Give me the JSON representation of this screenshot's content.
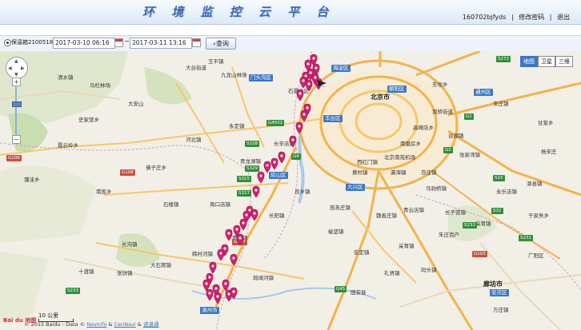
{
  "header": {
    "title": "环 境 监 控 云 平 台",
    "user": "160702bjfyds",
    "change_password": "修改密码",
    "logout": "退出",
    "sep": "|"
  },
  "toolbar": {
    "device": "保温箱21005183",
    "start_date": "2017-03-10 06:16",
    "end_date": "2017-03-11 13:16",
    "tilde": "~",
    "query": "查询"
  },
  "map": {
    "types": [
      "地图",
      "卫星",
      "三维"
    ],
    "active_type": "地图",
    "scale": "10 公里",
    "logo": "Bai du 地图",
    "copyright": {
      "prefix": "© 2015 Baidu - Data ©",
      "link1": "NavInfo",
      "amp": "&",
      "link2": "CenNavi",
      "amp2": "&",
      "link3": "道道通"
    },
    "place_labels": [
      {
        "text": "北京市",
        "big": true
      },
      {
        "text": "朝阳区",
        "badge": true
      },
      {
        "text": "海淀区",
        "badge": true
      },
      {
        "text": "门头沟区",
        "badge": true
      },
      {
        "text": "丰台区",
        "badge": true
      },
      {
        "text": "房山区",
        "badge": true
      },
      {
        "text": "大兴区",
        "badge": true
      },
      {
        "text": "通州区",
        "badge": true
      },
      {
        "text": "安次区",
        "badge": true
      },
      {
        "text": "涿州市",
        "badge": true
      },
      {
        "text": "廊坊市",
        "big": true
      },
      {
        "text": "大台街道"
      },
      {
        "text": "王平镇"
      },
      {
        "text": "清水镇"
      },
      {
        "text": "马栏林场"
      },
      {
        "text": "大安山"
      },
      {
        "text": "史家营乡"
      },
      {
        "text": "霞云岭乡"
      },
      {
        "text": "河北镇"
      },
      {
        "text": "周口店镇"
      },
      {
        "text": "韩村河镇"
      },
      {
        "text": "良乡镇"
      },
      {
        "text": "长阳镇"
      },
      {
        "text": "青龙湖镇"
      },
      {
        "text": "窦店镇"
      },
      {
        "text": "琉璃河镇"
      },
      {
        "text": "长沟镇"
      },
      {
        "text": "大石窝镇"
      },
      {
        "text": "张坊镇"
      },
      {
        "text": "十渡镇"
      },
      {
        "text": "蒲洼乡"
      },
      {
        "text": "佛子庄乡"
      },
      {
        "text": "南窖乡"
      },
      {
        "text": "石楼镇"
      },
      {
        "text": "长辛店镇"
      },
      {
        "text": "永定镇"
      },
      {
        "text": "九龙山林场"
      },
      {
        "text": "北京南苑机场"
      },
      {
        "text": "黄村镇"
      },
      {
        "text": "亦庄镇"
      },
      {
        "text": "西红门镇"
      },
      {
        "text": "瀛海镇"
      },
      {
        "text": "庞各庄镇"
      },
      {
        "text": "魏善庄镇"
      },
      {
        "text": "青云店镇"
      },
      {
        "text": "长子营镇"
      },
      {
        "text": "采育镇"
      },
      {
        "text": "榆垡镇"
      },
      {
        "text": "礼贤镇"
      },
      {
        "text": "安定镇"
      },
      {
        "text": "固安县"
      },
      {
        "text": "码头镇"
      },
      {
        "text": "万庄镇"
      },
      {
        "text": "台湖镇"
      },
      {
        "text": "马驹桥镇"
      },
      {
        "text": "张家湾镇"
      },
      {
        "text": "永乐店镇"
      },
      {
        "text": "于家务乡"
      },
      {
        "text": "漷县镇"
      },
      {
        "text": "宋庄镇"
      },
      {
        "text": "双桥街道"
      },
      {
        "text": "东坝乡"
      },
      {
        "text": "广阳区"
      },
      {
        "text": "朱庄百户"
      },
      {
        "text": "采育镇"
      },
      {
        "text": "甘棠乡"
      },
      {
        "text": "杨宋庄"
      },
      {
        "text": "高碑店乡"
      },
      {
        "text": "南磨房乡"
      },
      {
        "text": "石景山区"
      }
    ],
    "road_shields": [
      {
        "text": "G4501"
      },
      {
        "text": "G108"
      },
      {
        "text": "G108"
      },
      {
        "text": "G107"
      },
      {
        "text": "G4"
      },
      {
        "text": "S328"
      },
      {
        "text": "S329"
      },
      {
        "text": "S315"
      },
      {
        "text": "S317"
      },
      {
        "text": "S233"
      },
      {
        "text": "G45"
      },
      {
        "text": "G1"
      },
      {
        "text": "G2"
      },
      {
        "text": "S15"
      },
      {
        "text": "S32"
      },
      {
        "text": "S231"
      },
      {
        "text": "S232"
      },
      {
        "text": "G103"
      },
      {
        "text": "S272"
      }
    ],
    "marker_count": 38
  },
  "colors": {
    "marker": "#d6216f",
    "ring_road": "#f7c76a",
    "highway": "#f5b24a",
    "water": "#a8c9ee",
    "greenery": "#c8ddb0",
    "district_badge": "#3b78c4"
  }
}
